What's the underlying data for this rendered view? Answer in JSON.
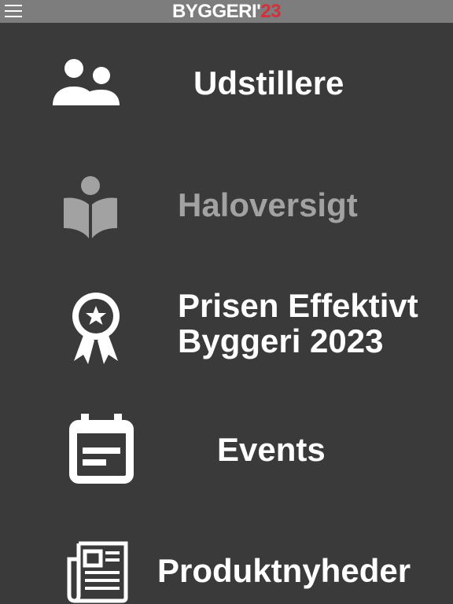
{
  "header": {
    "brand_main": "BYGGERI'",
    "brand_year": "23",
    "brand_colors": {
      "main": "#ffffff",
      "accent": "#d4303c"
    },
    "menu_icon": "hamburger-icon"
  },
  "menu": {
    "items": [
      {
        "label": "Udstillere",
        "icon": "people-icon",
        "state": "enabled"
      },
      {
        "label": "Haloversigt",
        "icon": "reader-book-icon",
        "state": "disabled"
      },
      {
        "label_line1": "Prisen Effektivt",
        "label_line2": "Byggeri 2023",
        "icon": "award-ribbon-icon",
        "state": "enabled"
      },
      {
        "label": "Events",
        "icon": "calendar-icon",
        "state": "enabled"
      },
      {
        "label": "Produktnyheder",
        "icon": "newspaper-icon",
        "state": "enabled"
      }
    ]
  }
}
